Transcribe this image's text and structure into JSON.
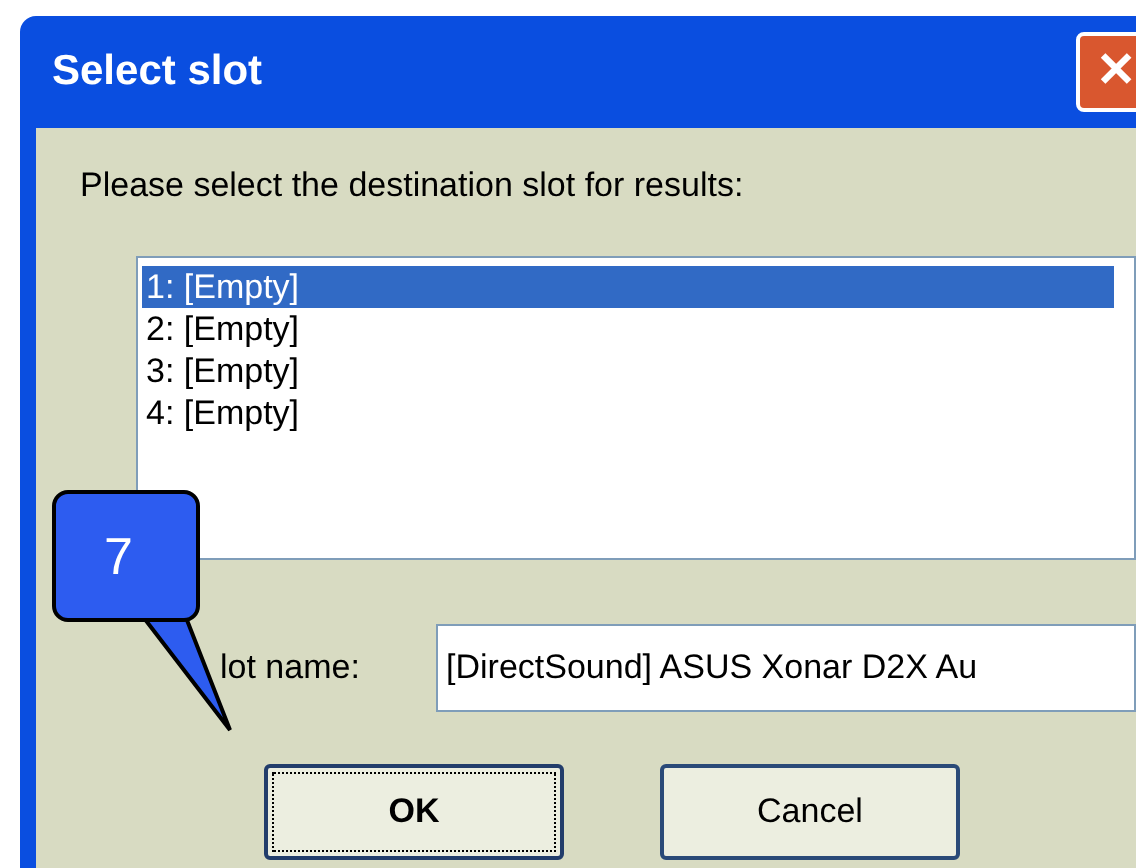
{
  "window": {
    "title": "Select slot",
    "close": "✕"
  },
  "prompt": "Please select the destination slot for results:",
  "slots": [
    {
      "label": "1: [Empty]",
      "selected": true
    },
    {
      "label": "2: [Empty]",
      "selected": false
    },
    {
      "label": "3: [Empty]",
      "selected": false
    },
    {
      "label": "4: [Empty]",
      "selected": false
    }
  ],
  "name_field": {
    "label": "lot name:",
    "value": "[DirectSound] ASUS Xonar D2X Au"
  },
  "buttons": [
    {
      "label": "OK",
      "default": true
    },
    {
      "label": "Cancel",
      "default": false
    }
  ],
  "callout": {
    "text": "7"
  }
}
